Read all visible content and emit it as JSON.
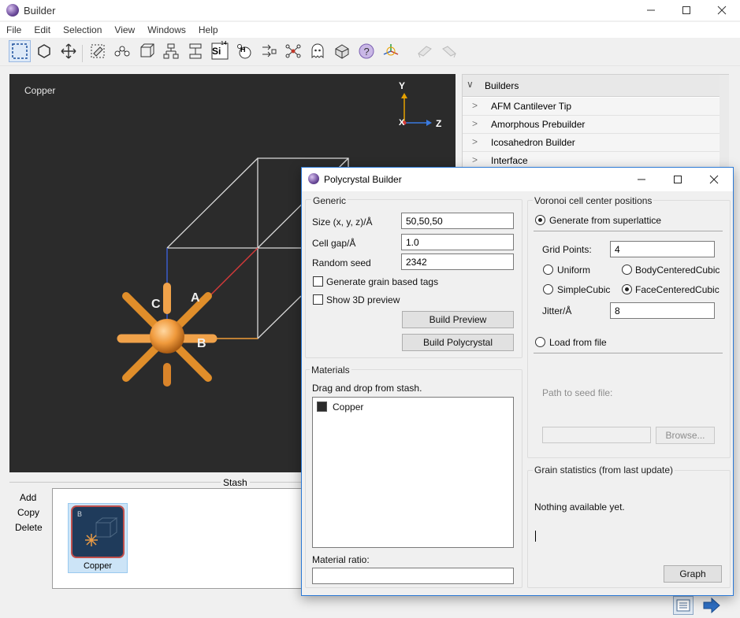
{
  "window": {
    "title": "Builder"
  },
  "menu": [
    "File",
    "Edit",
    "Selection",
    "View",
    "Windows",
    "Help"
  ],
  "toolbar": {
    "icons": [
      "select-rect-icon",
      "hexagon-icon",
      "move-icon",
      "tag-icon",
      "molecule-icon",
      "cube-icon",
      "tree-icon",
      "branch-icon",
      "element-si-icon",
      "atom-h-icon",
      "arrows-icon",
      "network-icon",
      "ghost-icon",
      "cube-rotate-icon",
      "help-icon",
      "axes-icon",
      "undo-icon",
      "redo-icon"
    ],
    "element_label": "Si",
    "element_number": "14",
    "atom_label": "H"
  },
  "viewport": {
    "label": "Copper",
    "axes": {
      "y": "Y",
      "x": "X",
      "z": "Z"
    },
    "lattice": {
      "a": "A",
      "b": "B",
      "c": "C"
    }
  },
  "builders": {
    "header": "Builders",
    "items": [
      "AFM Cantilever Tip",
      "Amorphous Prebuilder",
      "Icosahedron Builder",
      "Interface"
    ]
  },
  "stash": {
    "title": "Stash",
    "actions": [
      "Add",
      "Copy",
      "Delete"
    ],
    "items": [
      {
        "name": "Copper",
        "badge": "B"
      }
    ]
  },
  "dialog": {
    "title": "Polycrystal Builder",
    "generic": {
      "title": "Generic",
      "size_label": "Size (x, y, z)/Å",
      "size_value": "50,50,50",
      "cellgap_label": "Cell gap/Å",
      "cellgap_value": "1.0",
      "seed_label": "Random seed",
      "seed_value": "2342",
      "grain_tags_label": "Generate grain based tags",
      "grain_tags_checked": false,
      "preview3d_label": "Show 3D preview",
      "preview3d_checked": false,
      "build_preview": "Build Preview",
      "build_polycrystal": "Build Polycrystal"
    },
    "materials": {
      "title": "Materials",
      "hint": "Drag and drop from stash.",
      "items": [
        "Copper"
      ],
      "ratio_label": "Material ratio:",
      "ratio_value": ""
    },
    "voronoi": {
      "title": "Voronoi cell center positions",
      "superlattice_label": "Generate from superlattice",
      "superlattice_selected": true,
      "gridpoints_label": "Grid Points:",
      "gridpoints_value": "4",
      "lattice_options": [
        "Uniform",
        "BodyCenteredCubic",
        "SimpleCubic",
        "FaceCenteredCubic"
      ],
      "lattice_selected": "FaceCenteredCubic",
      "jitter_label": "Jitter/Å",
      "jitter_value": "8",
      "loadfile_label": "Load from file",
      "seedfile_label": "Path to seed file:",
      "seedfile_value": "",
      "browse": "Browse..."
    },
    "stats": {
      "title": "Grain statistics (from last update)",
      "text": "Nothing available yet.",
      "graph": "Graph"
    }
  }
}
